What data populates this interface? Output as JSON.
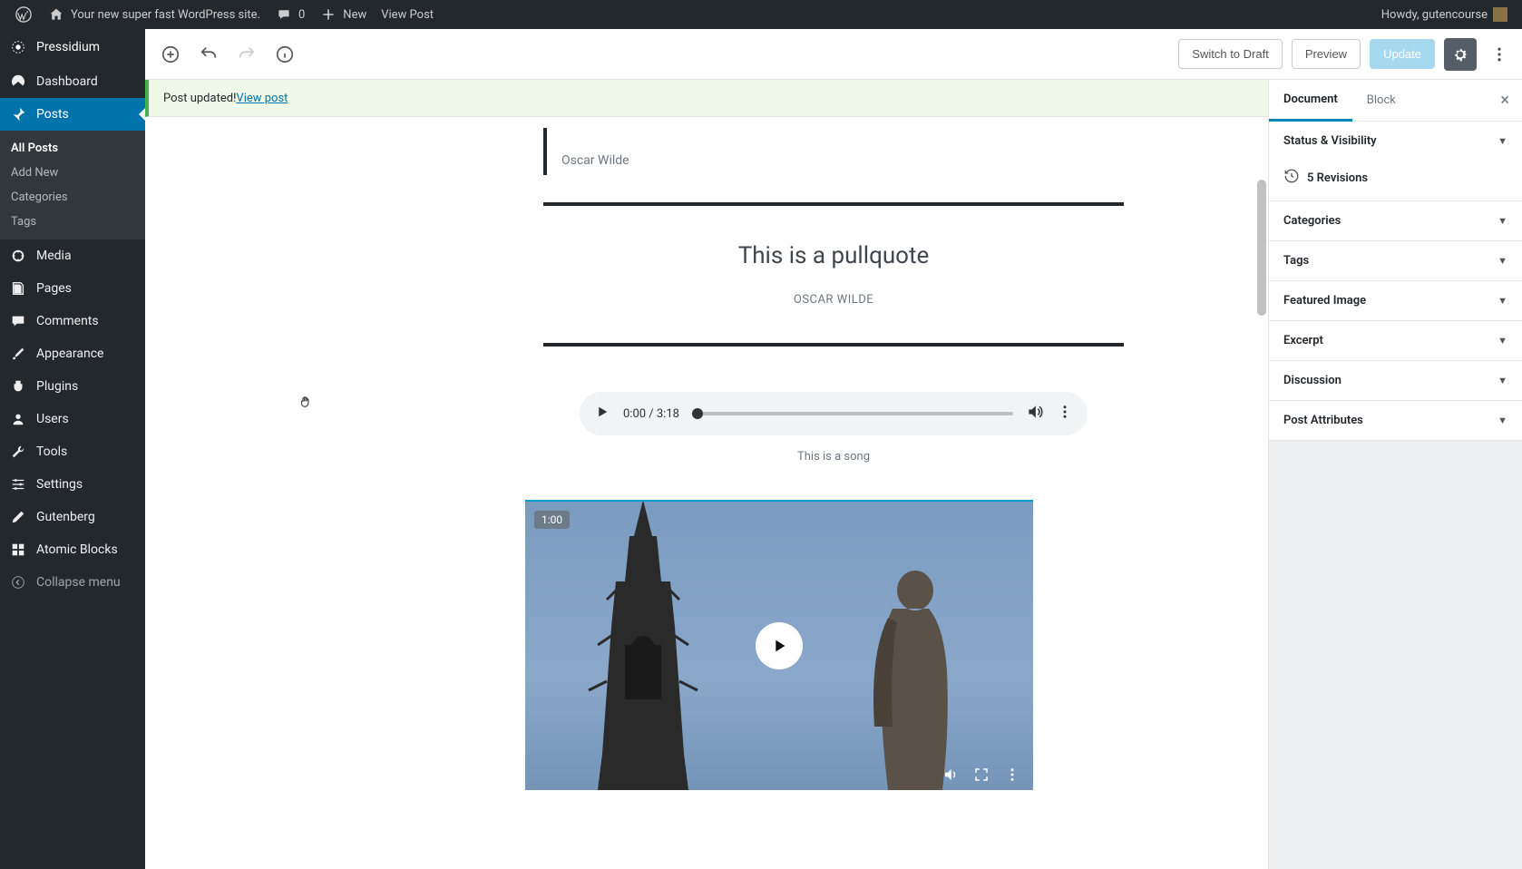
{
  "adminbar": {
    "site_title": "Your new super fast WordPress site.",
    "comments_count": "0",
    "new_label": "New",
    "view_post_label": "View Post",
    "howdy": "Howdy, gutencourse"
  },
  "sidebar": {
    "host": "Pressidium",
    "items": [
      {
        "label": "Dashboard"
      },
      {
        "label": "Posts"
      },
      {
        "label": "Media"
      },
      {
        "label": "Pages"
      },
      {
        "label": "Comments"
      },
      {
        "label": "Appearance"
      },
      {
        "label": "Plugins"
      },
      {
        "label": "Users"
      },
      {
        "label": "Tools"
      },
      {
        "label": "Settings"
      },
      {
        "label": "Gutenberg"
      },
      {
        "label": "Atomic Blocks"
      }
    ],
    "submenu": [
      {
        "label": "All Posts"
      },
      {
        "label": "Add New"
      },
      {
        "label": "Categories"
      },
      {
        "label": "Tags"
      }
    ],
    "collapse": "Collapse menu"
  },
  "toolbar": {
    "switch_draft": "Switch to Draft",
    "preview": "Preview",
    "update": "Update"
  },
  "notice": {
    "text": "Post updated! ",
    "link": "View post"
  },
  "content": {
    "quote_cite": "Oscar Wilde",
    "pullquote_text": "This is a pullquote",
    "pullquote_cite": "OSCAR WILDE",
    "audio_time": "0:00 / 3:18",
    "audio_caption": "This is a song",
    "video_duration": "1:00"
  },
  "rightpanel": {
    "tabs": {
      "document": "Document",
      "block": "Block"
    },
    "sections": {
      "status": "Status & Visibility",
      "revisions": "5 Revisions",
      "categories": "Categories",
      "tags": "Tags",
      "featured": "Featured Image",
      "excerpt": "Excerpt",
      "discussion": "Discussion",
      "attrs": "Post Attributes"
    }
  }
}
